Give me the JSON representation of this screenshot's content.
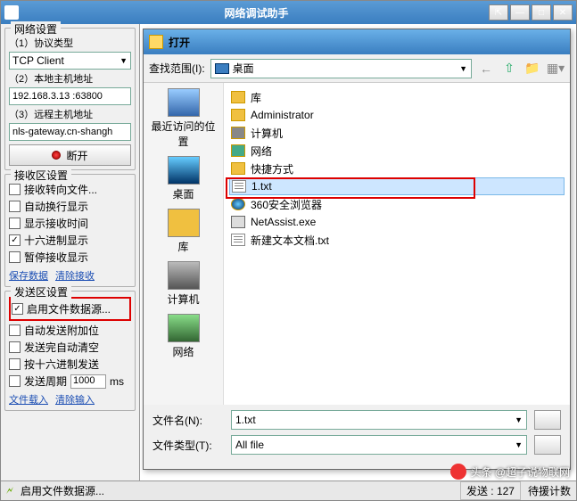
{
  "window": {
    "title": "网络调试助手"
  },
  "left": {
    "net_group": "网络设置",
    "proto_label": "（1）协议类型",
    "proto_value": "TCP Client",
    "local_label": "（2）本地主机地址",
    "local_value": "192.168.3.13 :63800",
    "remote_label": "（3）远程主机地址",
    "remote_value": "nls-gateway.cn-shangh",
    "disconnect": "断开",
    "recv_group": "接收区设置",
    "recv_items": [
      {
        "label": "接收转向文件...",
        "checked": false
      },
      {
        "label": "自动换行显示",
        "checked": false
      },
      {
        "label": "显示接收时间",
        "checked": false
      },
      {
        "label": "十六进制显示",
        "checked": true
      },
      {
        "label": "暂停接收显示",
        "checked": false
      }
    ],
    "recv_links": [
      "保存数据",
      "清除接收"
    ],
    "send_group": "发送区设置",
    "send_items": [
      {
        "label": "启用文件数据源...",
        "checked": true,
        "highlight": true
      },
      {
        "label": "自动发送附加位",
        "checked": false
      },
      {
        "label": "发送完自动清空",
        "checked": false
      },
      {
        "label": "按十六进制发送",
        "checked": false
      },
      {
        "label": "发送周期",
        "checked": false,
        "period": "1000",
        "unit": "ms"
      }
    ],
    "send_links": [
      "文件载入",
      "清除输入"
    ]
  },
  "dialog": {
    "title": "打开",
    "range_label": "查找范围(I):",
    "range_value": "桌面",
    "places": [
      {
        "label": "最近访问的位置",
        "cls": "recent"
      },
      {
        "label": "桌面",
        "cls": "desk"
      },
      {
        "label": "库",
        "cls": "lib"
      },
      {
        "label": "计算机",
        "cls": "comp"
      },
      {
        "label": "网络",
        "cls": "net"
      }
    ],
    "files": [
      {
        "label": "库",
        "cls": "folder"
      },
      {
        "label": "Administrator",
        "cls": "folder"
      },
      {
        "label": "计算机",
        "cls": "comp"
      },
      {
        "label": "网络",
        "cls": "net"
      },
      {
        "label": "快捷方式",
        "cls": "folder"
      },
      {
        "label": "1.txt",
        "cls": "txt",
        "selected": true
      },
      {
        "label": "360安全浏览器",
        "cls": "ie"
      },
      {
        "label": "NetAssist.exe",
        "cls": "exe"
      },
      {
        "label": "新建文本文档.txt",
        "cls": "txt"
      }
    ],
    "filename_label": "文件名(N):",
    "filename_value": "1.txt",
    "filetype_label": "文件类型(T):",
    "filetype_value": "All file"
  },
  "status": {
    "left": "启用文件数据源...",
    "send_label": "发送 :",
    "send_count": "127",
    "right": "待援计数"
  },
  "watermark": "头条 @超子说物联网"
}
